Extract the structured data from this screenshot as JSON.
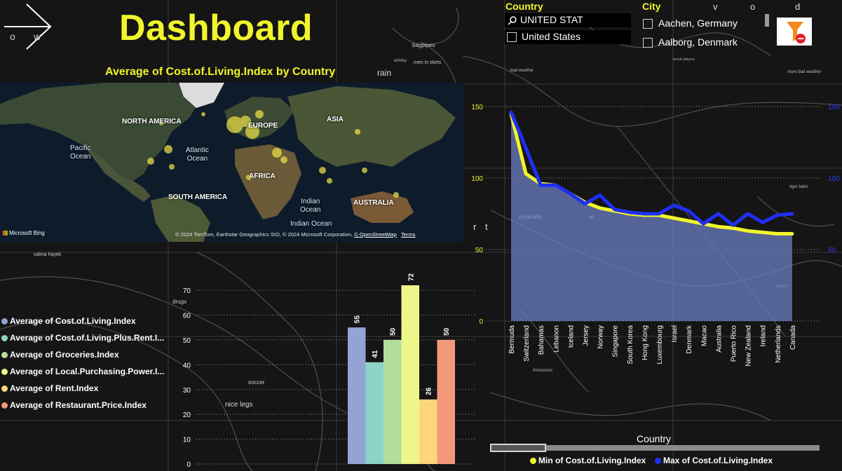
{
  "header": {
    "title": "Dashboard",
    "nav_icon": "arrow-right-icon",
    "nav_letter_left": "o",
    "nav_letter_right": "w"
  },
  "map": {
    "title": "Average of Cost.of.Living.Index by Country",
    "continents": [
      "NORTH AMERICA",
      "EUROPE",
      "ASIA",
      "AFRICA",
      "SOUTH AMERICA",
      "AUSTRALIA"
    ],
    "oceans": [
      "Pacific\nOcean",
      "Atlantic\nOcean",
      "Indian\nOcean",
      "Indian Ocean"
    ],
    "provider": "Microsoft Bing",
    "attribution": "© 2024 TomTom, Earthstar Geographics SIO, © 2024 Microsoft Corporation, ",
    "attribution_link": "© OpenStreetMap",
    "terms": "Terms"
  },
  "background_labels": [
    "bagpipes",
    "whisky",
    "men in skirts",
    "rain",
    "pyramids",
    "oil",
    "salma hayek",
    "drugs",
    "soccer",
    "nice legs",
    "more bad weather",
    "tiger balm",
    "pastry",
    "tennis players",
    "rhinoceros",
    "bad weather"
  ],
  "slicers": {
    "country": {
      "title": "Country",
      "search_value": "UNITED STAT",
      "options": [
        "United States"
      ]
    },
    "city": {
      "title": "City",
      "options": [
        "Aachen, Germany",
        "Aalborg, Denmark"
      ],
      "scroll_letters": [
        "v",
        "o",
        "d"
      ]
    },
    "clear_icon": "clear-filter-icon"
  },
  "bar_chart": {
    "legend": [
      {
        "label": "Average of Cost.of.Living.Index",
        "color": "#94a3d4"
      },
      {
        "label": "Average of Cost.of.Living.Plus.Rent.I...",
        "color": "#8dd3c7"
      },
      {
        "label": "Average of Groceries.Index",
        "color": "#b3de9a"
      },
      {
        "label": "Average of Local.Purchasing.Power.I...",
        "color": "#eef58a"
      },
      {
        "label": "Average of Rent.Index",
        "color": "#fdd67a"
      },
      {
        "label": "Average of Restaurant.Price.Index",
        "color": "#f4987a"
      }
    ]
  },
  "line_chart": {
    "x_axis_title": "Country",
    "legend": [
      {
        "label": "Min of Cost.of.Living.Index",
        "color": "#f1f52b"
      },
      {
        "label": "Max of Cost.of.Living.Index",
        "color": "#1e2ff5"
      }
    ],
    "overlay_letters": [
      "r",
      "t"
    ]
  },
  "chart_data": [
    {
      "type": "bar",
      "categories": [
        "Average of Cost.of.Living.Index",
        "Average of Cost.of.Living.Plus.Rent.I...",
        "Average of Groceries.Index",
        "Average of Local.Purchasing.Power.I...",
        "Average of Rent.Index",
        "Average of Restaurant.Price.Index"
      ],
      "values": [
        55,
        41,
        50,
        72,
        26,
        50
      ],
      "data_labels": [
        "55",
        "41",
        "50",
        "72",
        "26",
        "50"
      ],
      "colors": [
        "#94a3d4",
        "#8dd3c7",
        "#b3de9a",
        "#eef58a",
        "#fdd67a",
        "#f4987a"
      ],
      "ylim": [
        0,
        75
      ],
      "yticks": [
        0,
        10,
        20,
        30,
        40,
        50,
        60,
        70
      ],
      "grid": true,
      "legend_position": "left"
    },
    {
      "type": "line",
      "x": [
        "Bermuda",
        "Switzerland",
        "Bahamas",
        "Lebanon",
        "Iceland",
        "Jersey",
        "Norway",
        "Singapore",
        "South Korea",
        "Hong Kong",
        "Luxembourg",
        "Israel",
        "Denmark",
        "Macao",
        "Australia",
        "Puerto Rico",
        "New Zealand",
        "Ireland",
        "Netherlands",
        "Canada"
      ],
      "series": [
        {
          "name": "Min of Cost.of.Living.Index",
          "color": "#f1f52b",
          "values": [
            145,
            103,
            96,
            95,
            89,
            83,
            79,
            77,
            75,
            74,
            74,
            72,
            70,
            68,
            66,
            65,
            63,
            62,
            61,
            61
          ]
        },
        {
          "name": "Max of Cost.of.Living.Index",
          "color": "#1e2ff5",
          "values": [
            146,
            121,
            95,
            95,
            89,
            82,
            88,
            78,
            76,
            75,
            75,
            81,
            77,
            68,
            75,
            67,
            75,
            69,
            74,
            75
          ]
        }
      ],
      "area_series": "Min of Cost.of.Living.Index",
      "area_color": "#6b7fc2",
      "ylim": [
        0,
        150
      ],
      "yticks_left": [
        0,
        50,
        100,
        150
      ],
      "yticks_right": [
        50,
        100,
        150
      ],
      "left_tick_color": "#f1f52b",
      "right_tick_color": "#2a3cff",
      "xlabel": "Country",
      "grid": true,
      "legend_position": "bottom"
    }
  ]
}
